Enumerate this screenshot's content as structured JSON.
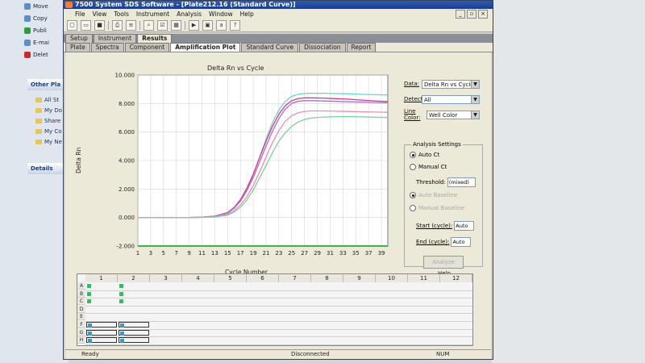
{
  "window": {
    "title": "7500 System SDS Software - [Plate212.16 (Standard Curve)]"
  },
  "menu": [
    "File",
    "View",
    "Tools",
    "Instrument",
    "Analysis",
    "Window",
    "Help"
  ],
  "tabs_main": [
    "Setup",
    "Instrument",
    "Results"
  ],
  "tabs_results": [
    "Plate",
    "Spectra",
    "Component",
    "Amplification Plot",
    "Standard Curve",
    "Dissociation",
    "Report"
  ],
  "explorer": {
    "tasks": [
      "Move",
      "Copy",
      "Publi",
      "E-mai",
      "Delet"
    ],
    "other_places": "Other Pla",
    "places": [
      "All St",
      "My Do",
      "Share",
      "My Co",
      "My Ne"
    ],
    "details": "Details"
  },
  "controls": {
    "data_label": "Data:",
    "data_value": "Delta Rn vs Cycle",
    "detector_label": "Detector:",
    "detector_value": "All",
    "line_color_label": "Line Color:",
    "line_color_value": "Well Color",
    "analysis_settings": "Analysis Settings",
    "auto_ct": "Auto Ct",
    "manual_ct": "Manual Ct",
    "threshold_label": "Threshold:",
    "threshold_value": "(mixed)",
    "auto_baseline": "Auto Baseline",
    "manual_baseline": "Manual Baseline",
    "start_label": "Start (cycle):",
    "start_value": "Auto",
    "end_label": "End (cycle):",
    "end_value": "Auto",
    "analyze": "Analyze",
    "help": "Help"
  },
  "grid": {
    "columns": [
      "1",
      "2",
      "3",
      "4",
      "5",
      "6",
      "7",
      "8",
      "9",
      "10",
      "11",
      "12"
    ],
    "rows": [
      "A",
      "B",
      "C",
      "D",
      "E",
      "F",
      "G",
      "H"
    ]
  },
  "status": {
    "left": "Ready",
    "middle": "Disconnected",
    "right": "NUM"
  },
  "chart_data": {
    "type": "line",
    "title": "Delta Rn vs Cycle",
    "xlabel": "Cycle Number",
    "ylabel": "Delta Rn",
    "xlim": [
      1,
      40
    ],
    "ylim": [
      -2000,
      10000
    ],
    "yticks": [
      10000,
      8000,
      6000,
      4000,
      2000,
      0,
      -2000
    ],
    "ytick_labels": [
      "10.000",
      "8.000",
      "6.000",
      "4.000",
      "2.000",
      "0.000",
      "-2.000"
    ],
    "xticks": [
      1,
      3,
      5,
      7,
      9,
      11,
      13,
      15,
      17,
      19,
      21,
      23,
      25,
      27,
      29,
      31,
      33,
      35,
      37,
      39
    ],
    "grid": true,
    "x": [
      1,
      5,
      9,
      11,
      13,
      15,
      16,
      17,
      18,
      19,
      20,
      21,
      22,
      23,
      24,
      25,
      26,
      27,
      28,
      30,
      32,
      34,
      36,
      38,
      40
    ],
    "series": [
      {
        "color": "#6fd3c4",
        "values": [
          0,
          0,
          0,
          20,
          80,
          300,
          620,
          1150,
          1950,
          3000,
          4250,
          5500,
          6650,
          7550,
          8150,
          8500,
          8650,
          8700,
          8720,
          8720,
          8700,
          8680,
          8650,
          8620,
          8600
        ]
      },
      {
        "color": "#d63a8f",
        "values": [
          0,
          0,
          0,
          25,
          100,
          350,
          700,
          1250,
          2050,
          3050,
          4200,
          5350,
          6400,
          7250,
          7850,
          8200,
          8350,
          8400,
          8400,
          8380,
          8340,
          8300,
          8240,
          8180,
          8140
        ]
      },
      {
        "color": "#b06ad0",
        "values": [
          0,
          0,
          0,
          20,
          90,
          320,
          650,
          1150,
          1880,
          2800,
          3900,
          5000,
          6050,
          6950,
          7600,
          8000,
          8150,
          8200,
          8200,
          8180,
          8150,
          8120,
          8100,
          8070,
          8050
        ]
      },
      {
        "color": "#e68fb5",
        "values": [
          0,
          0,
          0,
          15,
          60,
          220,
          470,
          880,
          1450,
          2250,
          3200,
          4250,
          5250,
          6100,
          6750,
          7150,
          7350,
          7450,
          7480,
          7480,
          7460,
          7440,
          7420,
          7400,
          7380
        ]
      },
      {
        "color": "#7fcf9a",
        "values": [
          0,
          0,
          0,
          10,
          40,
          170,
          380,
          720,
          1220,
          1930,
          2780,
          3650,
          4550,
          5350,
          5950,
          6400,
          6700,
          6880,
          6980,
          7050,
          7080,
          7080,
          7060,
          7040,
          7020
        ]
      }
    ]
  }
}
